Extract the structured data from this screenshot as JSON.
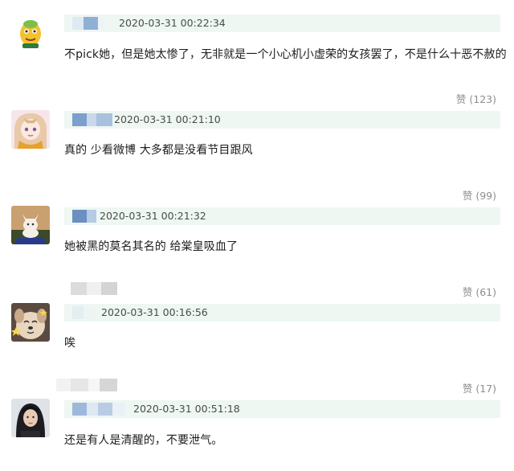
{
  "comments": [
    {
      "timestamp": "2020-03-31 00:22:34",
      "text": "不pick她，但是她太惨了，无非就是一个小心机小虚荣的女孩罢了，不是什么十恶不赦的",
      "like_label": "赞",
      "like_count": "(123)",
      "avatar": "avatar-cartoon-green-icon"
    },
    {
      "timestamp": "2020-03-31 00:21:10",
      "text": "真的 少看微博 大多都是没看节目跟风",
      "like_label": "赞",
      "like_count": "(99)",
      "avatar": "avatar-anime-girl-icon"
    },
    {
      "timestamp": "2020-03-31 00:21:32",
      "text": "她被黑的莫名其名的 给棠皇吸血了",
      "like_label": "赞",
      "like_count": "(61)",
      "avatar": "avatar-cat-icon"
    },
    {
      "timestamp": "2020-03-31 00:16:56",
      "text": "唉",
      "like_label": "赞",
      "like_count": "(17)",
      "avatar": "avatar-dog-icon"
    },
    {
      "timestamp": "2020-03-31 00:51:18",
      "text": "还是有人是清醒的，不要泄气。",
      "avatar": "avatar-girl-photo-icon"
    }
  ],
  "colors": {
    "header_bg": "#eef7f2",
    "mosaic_blue": "#8fb0d6",
    "mosaic_gray": "#d8d8d8",
    "text": "#1c1c1c",
    "muted": "#8e8e8e"
  }
}
